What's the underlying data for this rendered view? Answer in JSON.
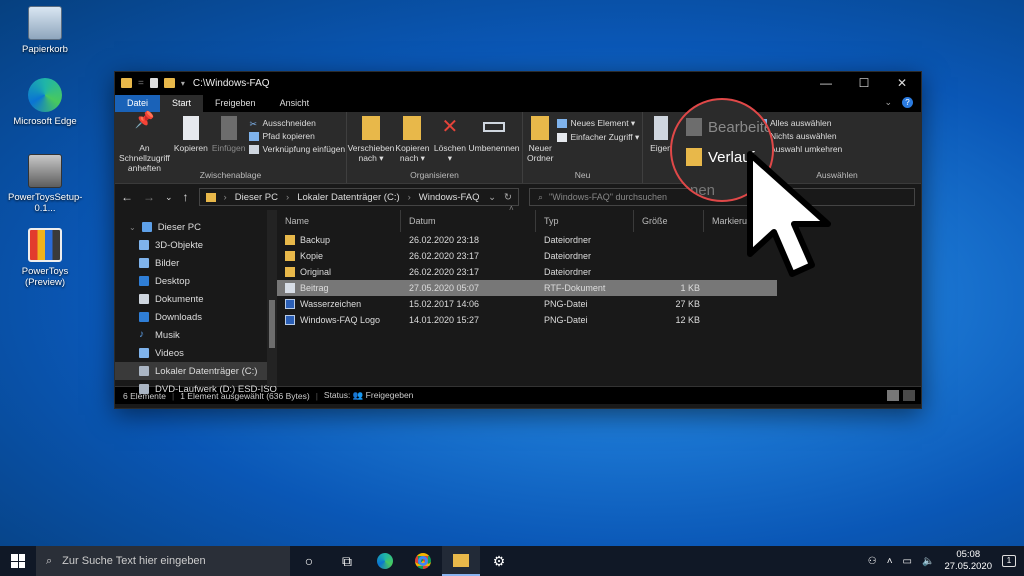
{
  "desktop": {
    "icons": [
      {
        "label": "Papierkorb",
        "icon": "recycle-bin-icon"
      },
      {
        "label": "Microsoft Edge",
        "icon": "edge-icon"
      },
      {
        "label": "PowerToysSetup-0.1...",
        "icon": "installer-icon"
      },
      {
        "label": "PowerToys (Preview)",
        "icon": "powertoys-icon"
      }
    ]
  },
  "window": {
    "title": "C:\\Windows-FAQ",
    "quick_access_sep": "=",
    "controls": {
      "minimize": "—",
      "maximize": "☐",
      "close": "✕"
    },
    "tabs": [
      "Datei",
      "Start",
      "Freigeben",
      "Ansicht"
    ],
    "active_tab": "Start",
    "help": "?",
    "ribbon": {
      "zwischenablage": {
        "label": "Zwischenablage",
        "pin": "An Schnellzugriff anheften",
        "copy": "Kopieren",
        "paste": "Einfügen",
        "cut": "Ausschneiden",
        "copy_path": "Pfad kopieren",
        "paste_link": "Verknüpfung einfügen"
      },
      "organisieren": {
        "label": "Organisieren",
        "move": "Verschieben nach ▾",
        "copyto": "Kopieren nach ▾",
        "delete": "Löschen ▾",
        "rename": "Umbenennen"
      },
      "neu": {
        "label": "Neu",
        "new_folder": "Neuer Ordner",
        "new_item": "Neues Element ▾",
        "easy_access": "Einfacher Zugriff ▾"
      },
      "oeffnen": {
        "props": "Eigen"
      },
      "auswaehlen": {
        "label": "Auswählen",
        "all": "Alles auswählen",
        "none": "Nichts auswählen",
        "invert": "Auswahl umkehren"
      }
    },
    "address": {
      "path": [
        "Dieser PC",
        "Lokaler Datenträger (C:)",
        "Windows-FAQ"
      ],
      "search_placeholder": "\"Windows-FAQ\" durchsuchen"
    },
    "nav": [
      {
        "label": "Dieser PC",
        "icon": "pc-icon",
        "color": "#5ea0e8"
      },
      {
        "label": "3D-Objekte",
        "icon": "3d-objects-icon",
        "color": "#7fb3ec"
      },
      {
        "label": "Bilder",
        "icon": "pictures-icon",
        "color": "#7fb3ec"
      },
      {
        "label": "Desktop",
        "icon": "desktop-icon",
        "color": "#2f7ed6"
      },
      {
        "label": "Dokumente",
        "icon": "documents-icon",
        "color": "#cfd6df"
      },
      {
        "label": "Downloads",
        "icon": "downloads-icon",
        "color": "#2f7ed6"
      },
      {
        "label": "Musik",
        "icon": "music-icon",
        "color": "#2f7ed6"
      },
      {
        "label": "Videos",
        "icon": "videos-icon",
        "color": "#7fb3ec"
      },
      {
        "label": "Lokaler Datenträger (C:)",
        "icon": "drive-icon",
        "color": "#aab5c3"
      },
      {
        "label": "DVD-Laufwerk (D:) ESD-ISO",
        "icon": "dvd-icon",
        "color": "#aab5c3"
      }
    ],
    "selected_nav": "Lokaler Datenträger (C:)",
    "columns": [
      "Name",
      "Datum",
      "Typ",
      "Größe",
      "Markierung"
    ],
    "files": [
      {
        "name": "Backup",
        "date": "26.02.2020 23:18",
        "type": "Dateiordner",
        "size": "",
        "kind": "folder"
      },
      {
        "name": "Kopie",
        "date": "26.02.2020 23:17",
        "type": "Dateiordner",
        "size": "",
        "kind": "folder"
      },
      {
        "name": "Original",
        "date": "26.02.2020 23:17",
        "type": "Dateiordner",
        "size": "",
        "kind": "folder"
      },
      {
        "name": "Beitrag",
        "date": "27.05.2020 05:07",
        "type": "RTF-Dokument",
        "size": "1 KB",
        "kind": "rtf"
      },
      {
        "name": "Wasserzeichen",
        "date": "15.02.2017 14:06",
        "type": "PNG-Datei",
        "size": "27 KB",
        "kind": "png"
      },
      {
        "name": "Windows-FAQ Logo",
        "date": "14.01.2020 15:27",
        "type": "PNG-Datei",
        "size": "12 KB",
        "kind": "png"
      }
    ],
    "selected_file": "Beitrag",
    "status": {
      "count": "6 Elemente",
      "selection": "1 Element ausgewählt (636 Bytes)",
      "share": "Status: 👥 Freigegeben"
    }
  },
  "zoom": {
    "edit": "Bearbeiten",
    "history": "Verlauf",
    "partial": "nen"
  },
  "taskbar": {
    "search_placeholder": "Zur Suche Text hier eingeben",
    "time": "05:08",
    "date": "27.05.2020",
    "notifications": "1"
  },
  "colors": {
    "accent": "#1a62b8",
    "highlight_ring": "#e04848",
    "folder": "#e8b84a"
  }
}
